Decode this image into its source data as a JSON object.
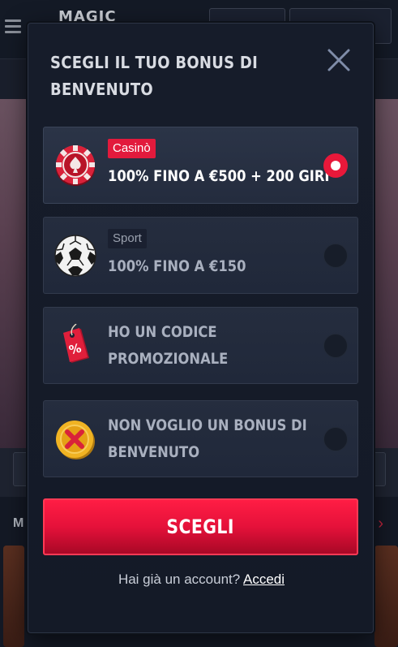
{
  "background": {
    "logo": "MAGIC"
  },
  "modal": {
    "title": "SCEGLI IL TUO BONUS DI BENVENUTO",
    "close_icon": "close-icon",
    "options": [
      {
        "badge": "Casinò",
        "label": "100% FINO A €500 + 200 GIRI",
        "icon": "casino-chip-icon",
        "selected": true
      },
      {
        "badge": "Sport",
        "label": "100% FINO A €150",
        "icon": "soccer-ball-icon",
        "selected": false
      },
      {
        "badge": "",
        "label_line1": "HO UN CODICE",
        "label_line2": "PROMOZIONALE",
        "icon": "promo-tag-icon",
        "selected": false
      },
      {
        "badge": "",
        "label_line1": "NON VOGLIO UN BONUS DI",
        "label_line2": "BENVENUTO",
        "icon": "no-bonus-coin-icon",
        "selected": false
      }
    ],
    "cta_label": "SCEGLI",
    "footer_text": "Hai già un account?",
    "login_label": "Accedi"
  },
  "colors": {
    "accent": "#e8183a",
    "modal_bg": "#161c2a",
    "option_bg": "#252d3e"
  }
}
